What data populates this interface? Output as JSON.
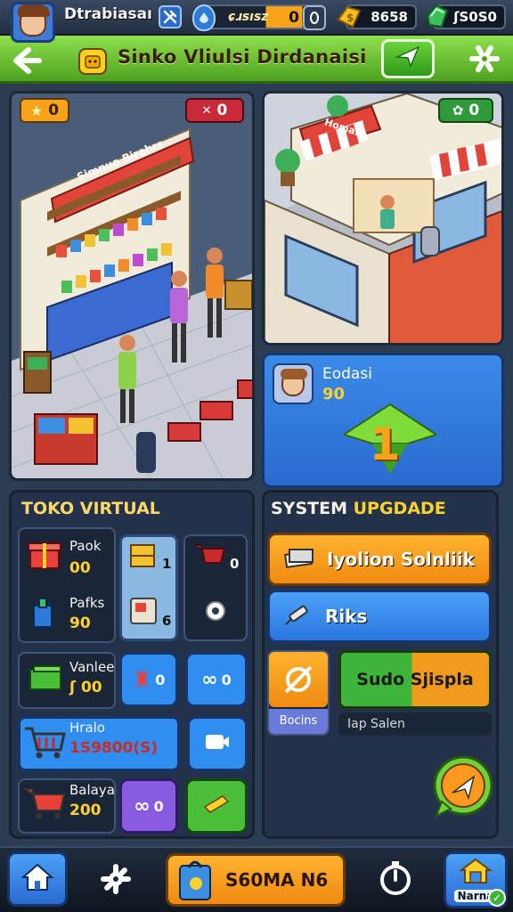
{
  "topbar": {
    "username": "Dtrabiasaı",
    "resources": [
      {
        "icon": "wrench-icon",
        "value": "ɕɹsısz"
      },
      {
        "icon": "energy-icon",
        "value": "0"
      },
      {
        "icon": "gold-icon",
        "value": "8658"
      },
      {
        "icon": "gem-icon",
        "value": "ʃS0S0"
      }
    ]
  },
  "titlebar": {
    "title": "Sinko Vliulsi Dirdanaisi",
    "back_icon": "back-arrow-icon",
    "share_icon": "send-icon",
    "settings_icon": "gear-icon"
  },
  "scene_left": {
    "star_badge": {
      "icon": "star-icon",
      "value": "0"
    },
    "cost_badge": {
      "icon": "price-icon",
      "value": "0"
    },
    "shop_sign": "Simnuo Birahrs"
  },
  "scene_right": {
    "badge": {
      "icon": "clover-icon",
      "value": "0"
    },
    "shop_sign": "Homaso"
  },
  "levelup": {
    "name": "Eodasi",
    "value": "90",
    "level": "1"
  },
  "toko": {
    "title": "TOKO VIRTUAL",
    "items": [
      {
        "label": "Paok",
        "value": "00"
      },
      {
        "label": "Pafks",
        "value": "90"
      },
      {
        "label": "Vanlee",
        "value": "ʃ 00"
      },
      {
        "label": "Hralo",
        "value": "1S9800(S)"
      },
      {
        "label": "Balaya",
        "value": "200"
      }
    ],
    "slots": [
      "1",
      "6",
      "0",
      "0",
      "0",
      "0"
    ]
  },
  "system": {
    "title_a": "SYSTEM",
    "title_b": "UPGDADE",
    "btn1": "Iyolion Solnliik",
    "btn2": "Riks",
    "tile_label": "Bocins",
    "green_btn": "Sudo Sjispla",
    "subtext": "Iap Salen"
  },
  "bottom": {
    "center_label": "S60MA N6",
    "right_label": "Narna"
  },
  "colors": {
    "title_green": "#6fc83a",
    "accent_orange": "#f6a21a",
    "accent_blue": "#2f8ef0",
    "gold_text": "#ffd22e"
  }
}
